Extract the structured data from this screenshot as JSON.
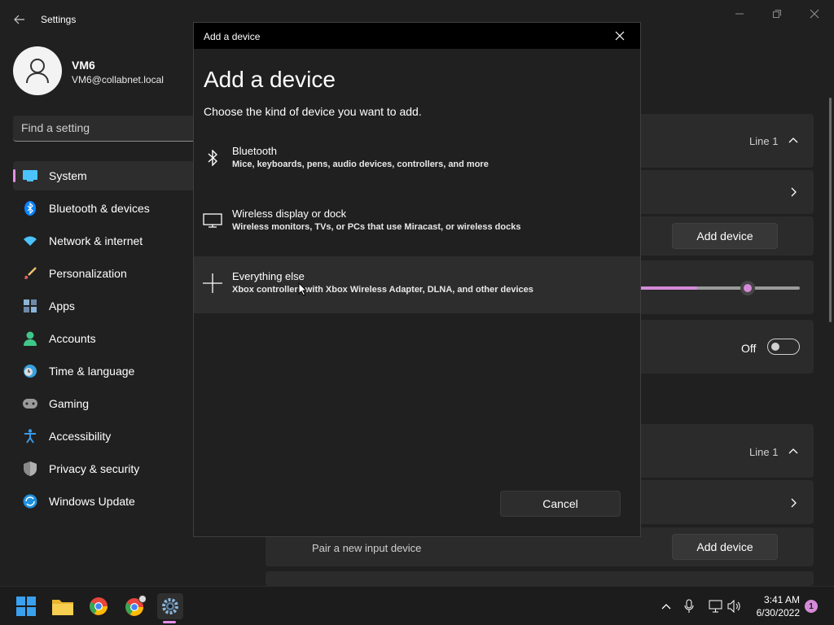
{
  "app": {
    "title": "Settings",
    "back_label": "Back"
  },
  "user": {
    "name": "VM6",
    "email": "VM6@collabnet.local"
  },
  "search": {
    "placeholder": "Find a setting"
  },
  "nav": {
    "items": [
      {
        "label": "System",
        "icon": "monitor-icon",
        "active": true
      },
      {
        "label": "Bluetooth & devices",
        "icon": "bluetooth-icon"
      },
      {
        "label": "Network & internet",
        "icon": "wifi-icon"
      },
      {
        "label": "Personalization",
        "icon": "brush-icon"
      },
      {
        "label": "Apps",
        "icon": "apps-icon"
      },
      {
        "label": "Accounts",
        "icon": "person-icon"
      },
      {
        "label": "Time & language",
        "icon": "globe-clock-icon"
      },
      {
        "label": "Gaming",
        "icon": "controller-icon"
      },
      {
        "label": "Accessibility",
        "icon": "accessibility-icon"
      },
      {
        "label": "Privacy & security",
        "icon": "shield-icon"
      },
      {
        "label": "Windows Update",
        "icon": "update-icon"
      }
    ]
  },
  "background": {
    "line1_a": "Line 1",
    "line1_b": "Line 1",
    "add_device_a": "Add device",
    "add_device_b": "Add device",
    "off_label": "Off",
    "pair_text": "Pair a new input device",
    "slider_value_fraction": 0.67
  },
  "dialog": {
    "window_title": "Add a device",
    "heading": "Add a device",
    "subtitle": "Choose the kind of device you want to add.",
    "options": [
      {
        "title": "Bluetooth",
        "desc": "Mice, keyboards, pens, audio devices, controllers, and more",
        "icon": "bluetooth-icon"
      },
      {
        "title": "Wireless display or dock",
        "desc": "Wireless monitors, TVs, or PCs that use Miracast, or wireless docks",
        "icon": "monitor-icon"
      },
      {
        "title": "Everything else",
        "desc": "Xbox controllers with Xbox Wireless Adapter, DLNA, and other devices",
        "icon": "plus-icon"
      }
    ],
    "cancel_label": "Cancel"
  },
  "taskbar": {
    "clock_time": "3:41 AM",
    "clock_date": "6/30/2022",
    "notification_count": "1",
    "pinned": [
      "windows-start-icon",
      "file-explorer-icon",
      "chrome-icon",
      "chrome-profile-icon",
      "settings-icon"
    ]
  },
  "colors": {
    "accent": "#e58ee8",
    "slider": "#d58ad8",
    "window_bg": "#202020",
    "card_bg": "#2b2b2b"
  }
}
